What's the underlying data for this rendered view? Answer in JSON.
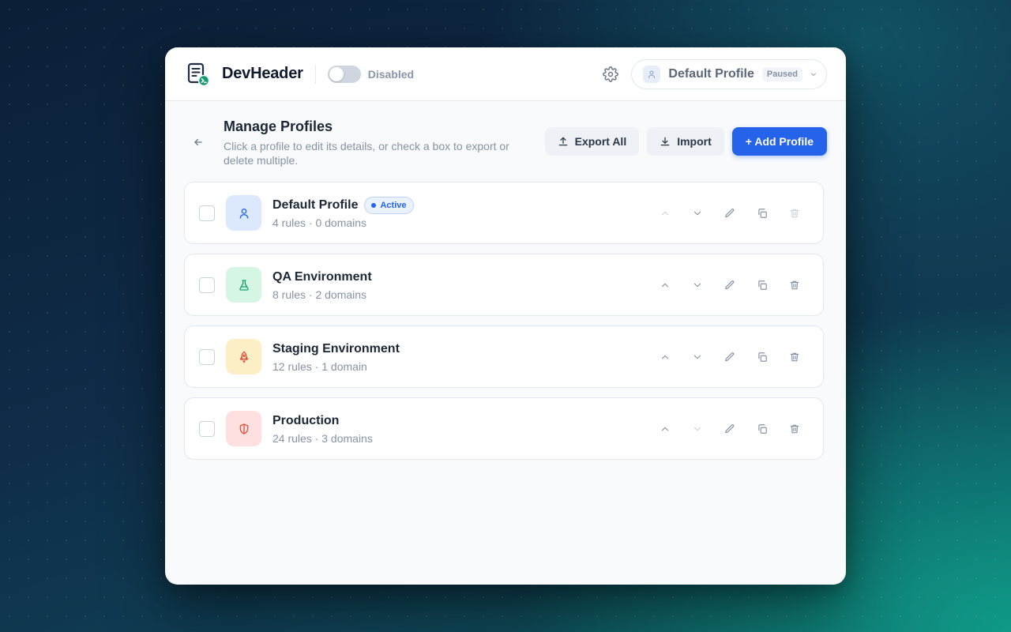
{
  "app": {
    "name": "DevHeader",
    "toggle_label": "Disabled",
    "toggle_on": false,
    "profile_selector": {
      "name": "Default Profile",
      "badge": "Paused"
    }
  },
  "page": {
    "title": "Manage Profiles",
    "subtitle": "Click a profile to edit its details, or check a box to export or delete multiple.",
    "actions": {
      "export_label": "Export All",
      "import_label": "Import",
      "add_label": "+ Add Profile"
    }
  },
  "profiles": [
    {
      "name": "Default Profile",
      "meta": "4 rules · 0 domains",
      "badge": "Active",
      "color": "#2563eb",
      "bg": "#dbe8fd",
      "icon": "user-icon"
    },
    {
      "name": "QA Environment",
      "meta": "8 rules · 2 domains",
      "badge": "",
      "color": "#16a36b",
      "bg": "#d5f5e5",
      "icon": "flask-icon"
    },
    {
      "name": "Staging Environment",
      "meta": "12 rules · 1 domain",
      "badge": "",
      "color": "#d99a06",
      "bg": "#fcefc6",
      "icon": "rocket-icon"
    },
    {
      "name": "Production",
      "meta": "24 rules · 3 domains",
      "badge": "",
      "color": "#e0533f",
      "bg": "#fde0df",
      "icon": "shield-icon"
    }
  ],
  "colors": {
    "accent": "#2563eb",
    "text": "#1c2736",
    "muted": "#8793a4"
  }
}
